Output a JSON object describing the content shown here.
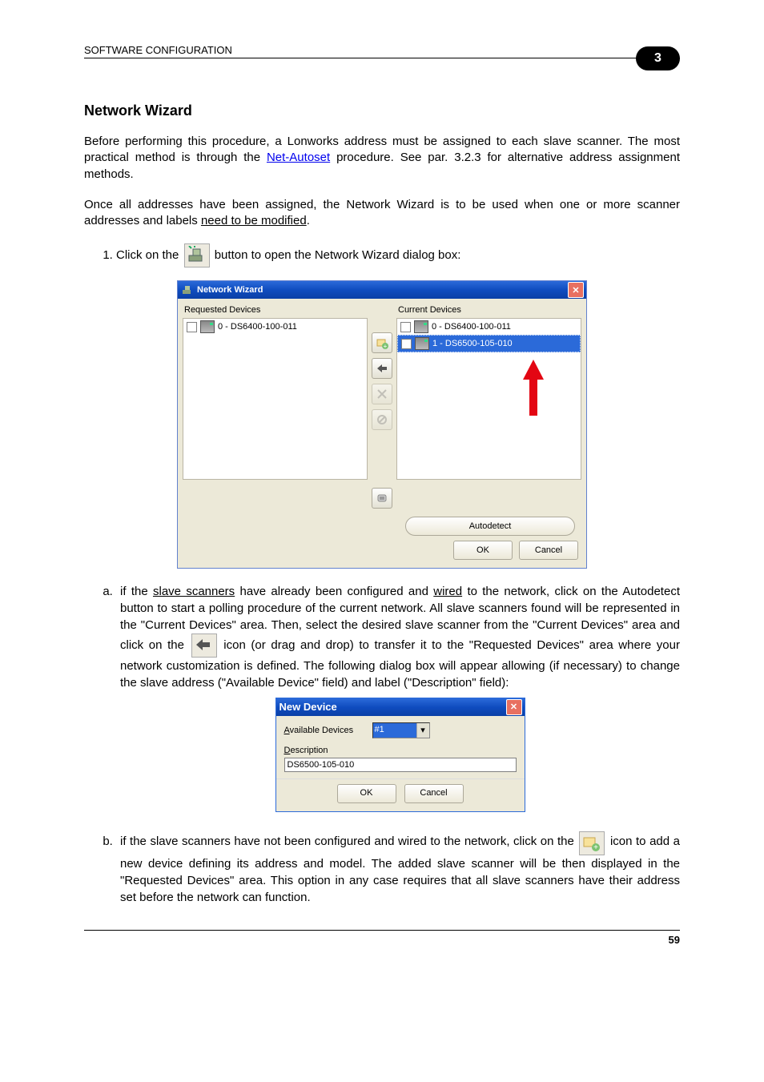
{
  "header": {
    "section": "SOFTWARE CONFIGURATION",
    "chapter": "3"
  },
  "section_title": "Network Wizard",
  "intro_paragraph_parts": {
    "p1a": "Before performing this procedure, a Lonworks address must be assigned to each slave scanner. The most practical method is through the ",
    "p1_link": "Net-Autoset",
    "p1b": " procedure. See par. 3.2.3 for alternative address assignment methods."
  },
  "para2_parts": {
    "a": "Once all addresses have been assigned, the Network Wizard is to be used when one or more scanner addresses and labels ",
    "b": "need to be modified",
    "c": "."
  },
  "step1": {
    "pre": "Click on the ",
    "post": " button to open the Network Wizard dialog box:"
  },
  "wizard": {
    "title": "Network Wizard",
    "left_label": "Requested Devices",
    "right_label": "Current Devices",
    "left_items": [
      {
        "label": "0 - DS6400-100-011"
      }
    ],
    "right_items": [
      {
        "label": "0 - DS6400-100-011",
        "selected": false
      },
      {
        "label": "1 - DS6500-105-010",
        "selected": true
      }
    ],
    "buttons": {
      "autodetect": "Autodetect",
      "ok": "OK",
      "cancel": "Cancel"
    }
  },
  "letter_a": {
    "a": "if the ",
    "b": "slave scanners",
    "c": " have already been configured and ",
    "d": "wired",
    "e": " to the network, click on the Autodetect button to start a polling procedure of the current network. All slave scanners found will be represented in the \"Current Devices\" area. Then, select the desired slave scanner from the \"Current Devices\" area and click on the ",
    "f": " icon (or drag and drop) to transfer it to the \"Requested Devices\" area where your network customization is defined. The following dialog box will appear allowing (if necessary) to change the slave address (\"Available Device\" field) and label (\"Description\" field):"
  },
  "newdev": {
    "title": "New Device",
    "available_label": "Available Devices",
    "available_value": "#1",
    "description_label": "Description",
    "description_value": "DS6500-105-010",
    "ok": "OK",
    "cancel": "Cancel"
  },
  "letter_b": {
    "a": "if the slave scanners have not been configured and wired to the network, click on the ",
    "b": " icon to add a new device defining its address and model. The added slave scanner will be then displayed in the \"Requested Devices\" area. This option in any case requires that all slave scanners have their address set before the network can function."
  },
  "page_number": "59"
}
